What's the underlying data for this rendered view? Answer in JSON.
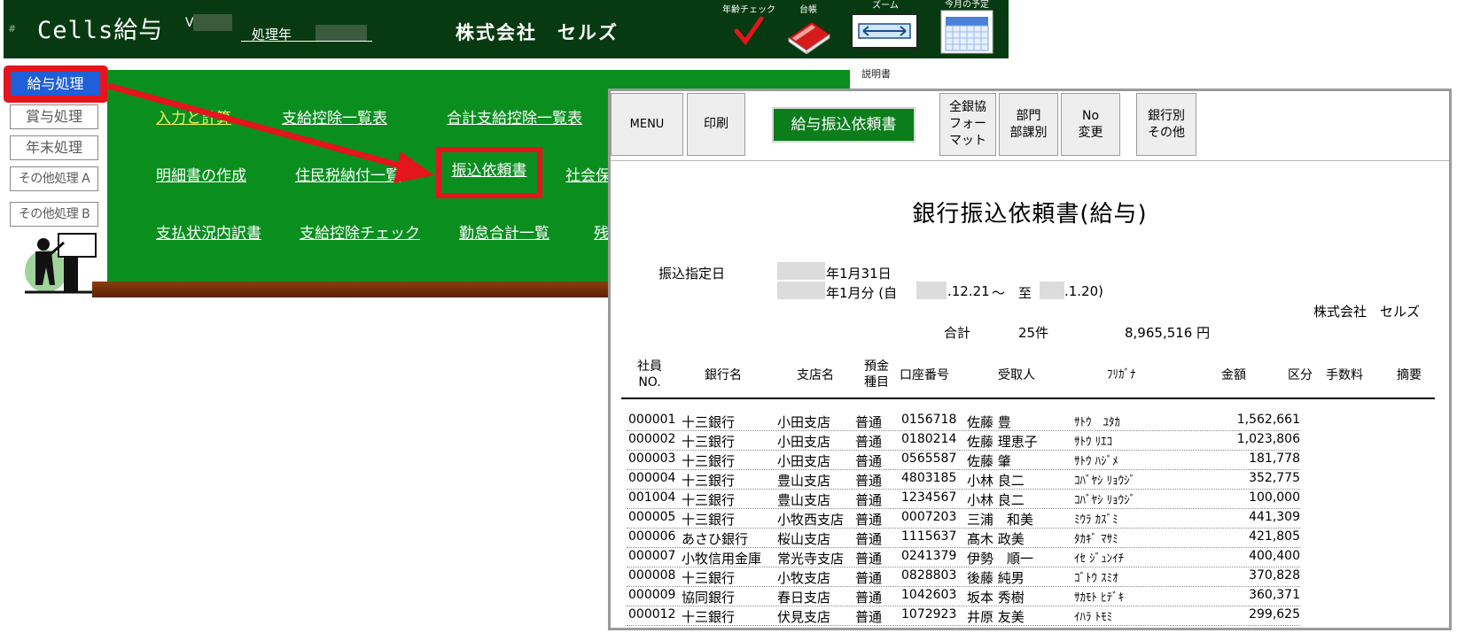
{
  "header": {
    "hash": "#",
    "app_title": "Cells給与",
    "version_label": "V",
    "year_label": "処理年",
    "company": "株式会社　セルズ",
    "age_check_label": "年齢チェック",
    "ledger_label": "台帳",
    "zoom_label": "ズーム",
    "monthly_label": "今月の予定"
  },
  "left_menu": {
    "kyuyo": "給与処理",
    "shoyo": "賞与処理",
    "nenmatsu": "年末処理",
    "other_a": "その他処理 A",
    "other_b": "その他処理 B"
  },
  "board": {
    "input": "入力と計算",
    "ichiran": "支給控除一覧表",
    "gokei": "合計支給控除一覧表",
    "meisai": "明細書の作成",
    "jumin": "住民税納付一覧",
    "furikomi": "振込依頼書",
    "shakai": "社会保",
    "shiharai": "支払状況内訳書",
    "check": "支給控除チェック",
    "kintai": "勤怠合計一覧",
    "zan": "残"
  },
  "manual_label": "説明書",
  "preview": {
    "toolbar": {
      "menu": "MENU",
      "print": "印刷",
      "title": "給与振込依頼書",
      "zengin": "全銀協\nフォー\nマット",
      "bumon": "部門\n部課別",
      "no": "No\n変更",
      "ginko": "銀行別\nその他"
    },
    "doc_title": "銀行振込依頼書(給与)",
    "date_label": "振込指定日",
    "date_value": "年1月31日",
    "period_prefix": "年1月分 (自",
    "period_from": ".12.21",
    "period_sep": "〜　至",
    "period_to": ".1.20)",
    "company": "株式会社　セルズ",
    "total_label": "合計",
    "total_count": "25件",
    "total_amount": "8,965,516 円",
    "columns": {
      "no": "社員\nNO.",
      "bank": "銀行名",
      "branch": "支店名",
      "type": "預金\n種目",
      "acct": "口座番号",
      "name": "受取人",
      "kana": "ﾌﾘｶﾞﾅ",
      "amount": "金額",
      "kubun": "区分",
      "fee": "手数料",
      "memo": "摘要"
    },
    "rows": [
      {
        "no": "000001",
        "bank": "十三銀行",
        "branch": "小田支店",
        "type": "普通",
        "acct": "0156718",
        "name": "佐藤 豊",
        "kana": "ｻﾄｳ　ﾕﾀｶ",
        "amount": "1,562,661"
      },
      {
        "no": "000002",
        "bank": "十三銀行",
        "branch": "小田支店",
        "type": "普通",
        "acct": "0180214",
        "name": "佐藤 理恵子",
        "kana": "ｻﾄｳ ﾘｴｺ",
        "amount": "1,023,806"
      },
      {
        "no": "000003",
        "bank": "十三銀行",
        "branch": "小田支店",
        "type": "普通",
        "acct": "0565587",
        "name": "佐藤 肇",
        "kana": "ｻﾄｳ ﾊｼﾞﾒ",
        "amount": "181,778"
      },
      {
        "no": "000004",
        "bank": "十三銀行",
        "branch": "豊山支店",
        "type": "普通",
        "acct": "4803185",
        "name": "小林 良二",
        "kana": "ｺﾊﾞﾔｼ ﾘｮｳｼﾞ",
        "amount": "352,775"
      },
      {
        "no": "001004",
        "bank": "十三銀行",
        "branch": "豊山支店",
        "type": "普通",
        "acct": "1234567",
        "name": "小林 良二",
        "kana": "ｺﾊﾞﾔｼ ﾘｮｳｼﾞ",
        "amount": "100,000"
      },
      {
        "no": "000005",
        "bank": "十三銀行",
        "branch": "小牧西支店",
        "type": "普通",
        "acct": "0007203",
        "name": "三浦　和美",
        "kana": "ﾐｳﾗ ｶｽﾞﾐ",
        "amount": "441,309"
      },
      {
        "no": "000006",
        "bank": "あさひ銀行",
        "branch": "桜山支店",
        "type": "普通",
        "acct": "1115637",
        "name": "髙木 政美",
        "kana": "ﾀｶｷﾞ ﾏｻﾐ",
        "amount": "421,805"
      },
      {
        "no": "000007",
        "bank": "小牧信用金庫",
        "branch": "常光寺支店",
        "type": "普通",
        "acct": "0241379",
        "name": "伊勢　順一",
        "kana": "ｲｾ ｼﾞｭﾝｲﾁ",
        "amount": "400,400"
      },
      {
        "no": "000008",
        "bank": "十三銀行",
        "branch": "小牧支店",
        "type": "普通",
        "acct": "0828803",
        "name": "後藤 純男",
        "kana": "ｺﾞﾄｳ ｽﾐｵ",
        "amount": "370,828"
      },
      {
        "no": "000009",
        "bank": "協同銀行",
        "branch": "春日支店",
        "type": "普通",
        "acct": "1042603",
        "name": "坂本 秀樹",
        "kana": "ｻｶﾓﾄ ﾋﾃﾞｷ",
        "amount": "360,371"
      },
      {
        "no": "000012",
        "bank": "十三銀行",
        "branch": "伏見支店",
        "type": "普通",
        "acct": "1072923",
        "name": "井原 友美",
        "kana": "ｲﾊﾗ ﾄﾓﾐ",
        "amount": "299,625"
      }
    ]
  },
  "colors": {
    "header_bg": "#073a10",
    "board_green": "#0a8f1f",
    "highlight_red": "#e4151c",
    "active_blue": "#1f5fd8"
  }
}
